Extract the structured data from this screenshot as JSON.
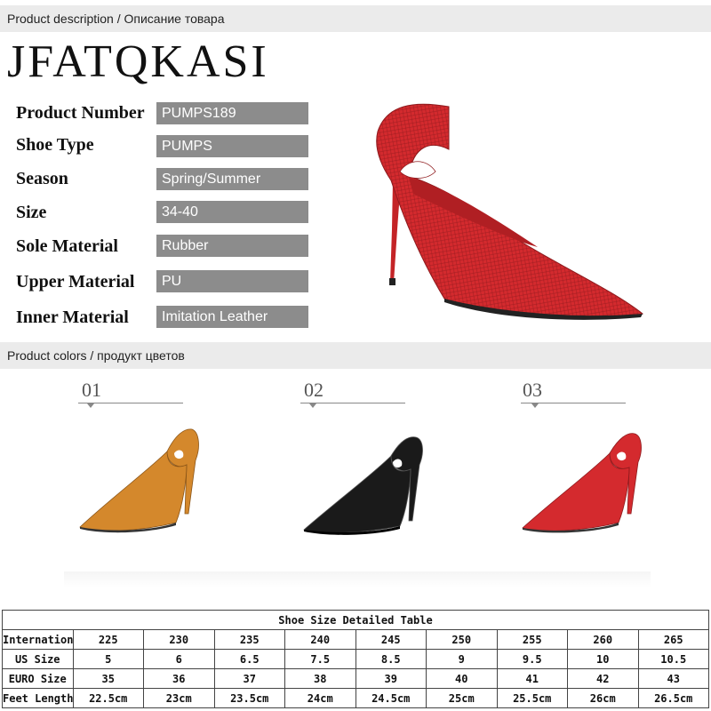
{
  "header": {
    "title": "Product description / Описание товара"
  },
  "brand": "JFATQKASI",
  "specs": [
    {
      "label": "Product Number",
      "value": "PUMPS189"
    },
    {
      "label": "Shoe Type",
      "value": "PUMPS"
    },
    {
      "label": "Season",
      "value": "Spring/Summer"
    },
    {
      "label": "Size",
      "value": "34-40"
    },
    {
      "label": "Sole Material",
      "value": "Rubber"
    },
    {
      "label": "Upper Material",
      "value": "PU"
    },
    {
      "label": "Inner Material",
      "value": "Imitation Leather"
    }
  ],
  "colors_section": {
    "title": "Product colors / продукт цветов",
    "items": [
      {
        "number": "01",
        "color": "#d4882c"
      },
      {
        "number": "02",
        "color": "#1a1a1a"
      },
      {
        "number": "03",
        "color": "#d42a2e"
      }
    ]
  },
  "hero": {
    "color": "#d42a2e"
  },
  "size_table": {
    "caption": "Shoe Size Detailed Table",
    "rows": [
      {
        "label": "International Size",
        "values": [
          "225",
          "230",
          "235",
          "240",
          "245",
          "250",
          "255",
          "260",
          "265"
        ]
      },
      {
        "label": "US Size",
        "values": [
          "5",
          "6",
          "6.5",
          "7.5",
          "8.5",
          "9",
          "9.5",
          "10",
          "10.5"
        ]
      },
      {
        "label": "EURO Size",
        "values": [
          "35",
          "36",
          "37",
          "38",
          "39",
          "40",
          "41",
          "42",
          "43"
        ]
      },
      {
        "label": "Feet Length",
        "values": [
          "22.5cm",
          "23cm",
          "23.5cm",
          "24cm",
          "24.5cm",
          "25cm",
          "25.5cm",
          "26cm",
          "26.5cm"
        ]
      }
    ]
  }
}
